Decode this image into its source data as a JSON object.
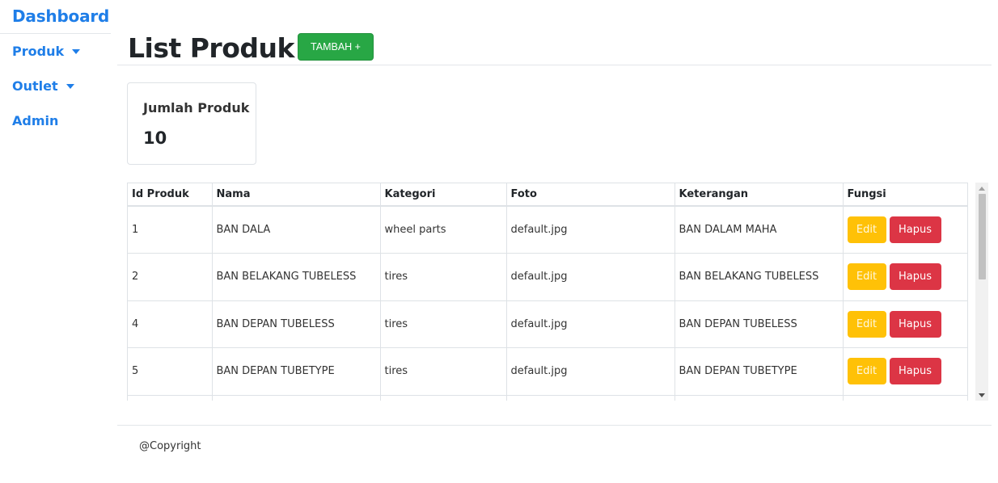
{
  "sidebar": {
    "brand": "Dashboard",
    "items": [
      {
        "label": "Produk",
        "has_caret": true
      },
      {
        "label": "Outlet",
        "has_caret": true
      },
      {
        "label": "Admin",
        "has_caret": false
      }
    ]
  },
  "header": {
    "title": "List Produk",
    "add_button": "TAMBAH +"
  },
  "stat_card": {
    "title": "Jumlah Produk",
    "value": "10"
  },
  "table": {
    "columns": [
      "Id Produk",
      "Nama",
      "Kategori",
      "Foto",
      "Keterangan",
      "Fungsi"
    ],
    "rows": [
      {
        "id": "1",
        "nama": "BAN DALA",
        "kategori": "wheel parts",
        "foto": "default.jpg",
        "keterangan": "BAN DALAM MAHA"
      },
      {
        "id": "2",
        "nama": "BAN BELAKANG TUBELESS",
        "kategori": "tires",
        "foto": "default.jpg",
        "keterangan": "BAN BELAKANG TUBELESS"
      },
      {
        "id": "4",
        "nama": "BAN DEPAN TUBELESS",
        "kategori": "tires",
        "foto": "default.jpg",
        "keterangan": "BAN DEPAN TUBELESS"
      },
      {
        "id": "5",
        "nama": "BAN DEPAN TUBETYPE",
        "kategori": "tires",
        "foto": "default.jpg",
        "keterangan": "BAN DEPAN TUBETYPE"
      },
      {
        "id": "",
        "nama": "",
        "kategori": "",
        "foto": "",
        "keterangan": ""
      }
    ],
    "edit_label": "Edit",
    "delete_label": "Hapus"
  },
  "footer": {
    "text": "@Copyright"
  },
  "colors": {
    "link": "#1f7ee8",
    "success": "#28a745",
    "warning": "#ffc107",
    "danger": "#dc3545"
  }
}
